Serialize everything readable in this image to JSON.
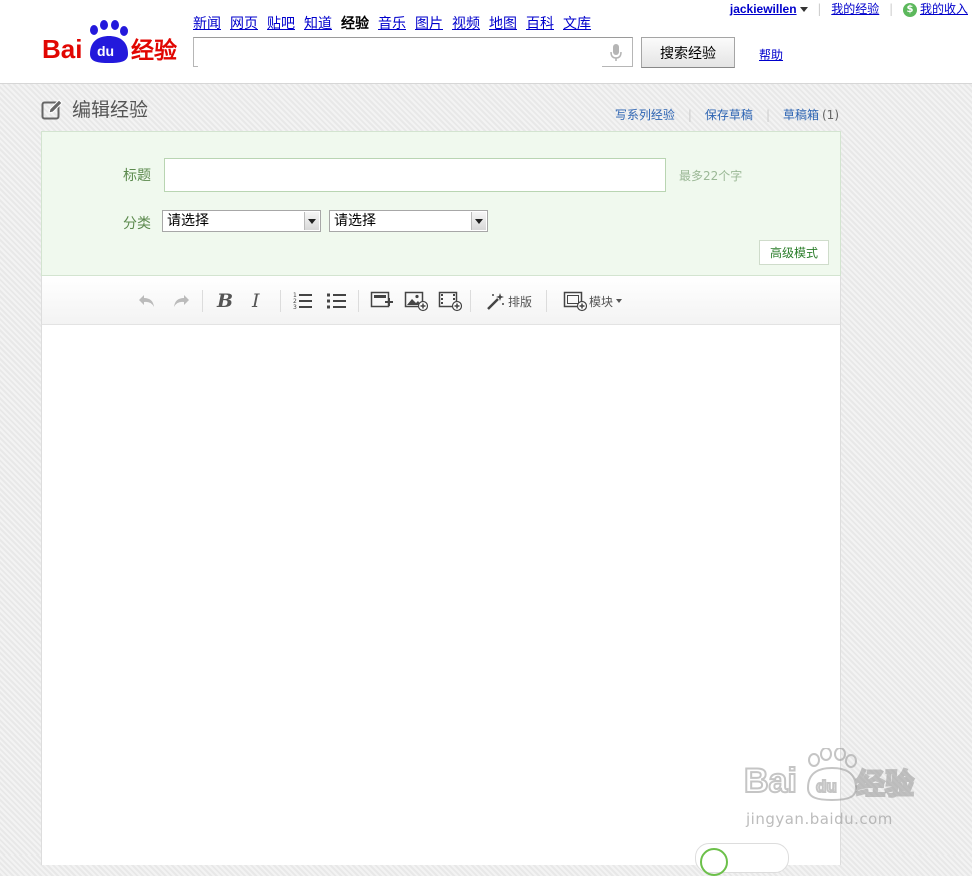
{
  "header": {
    "logo_text": "Baidu经验",
    "nav": [
      "新闻",
      "网页",
      "贴吧",
      "知道",
      "经验",
      "音乐",
      "图片",
      "视频",
      "地图",
      "百科",
      "文库"
    ],
    "nav_current": "经验",
    "search": {
      "value": "",
      "placeholder": "",
      "button_label": "搜索经验"
    },
    "help_label": "帮助",
    "user": {
      "name": "jackiewillen",
      "my_experience": "我的经验",
      "my_income": "我的收入"
    }
  },
  "page": {
    "title": "编辑经验",
    "actions": {
      "series": "写系列经验",
      "save_draft": "保存草稿",
      "drafts": "草稿箱",
      "drafts_count": "(1)"
    }
  },
  "form": {
    "title_label": "标题",
    "title_value": "",
    "title_hint": "最多22个字",
    "category_label": "分类",
    "category1": "请选择",
    "category2": "请选择",
    "advanced_button": "高级模式"
  },
  "toolbar": {
    "items": [
      "undo-icon",
      "redo-icon",
      "bold-icon",
      "italic-icon",
      "ordered-list-icon",
      "unordered-list-icon",
      "insert-step-icon",
      "insert-image-icon",
      "insert-video-icon",
      "magic-wand-icon",
      "module-icon"
    ],
    "layout_label": "排版",
    "module_label": "模块"
  },
  "editor": {
    "content": ""
  },
  "watermark": {
    "brand": "Baidu经验",
    "url": "jingyan.baidu.com"
  },
  "colors": {
    "accent_green": "#5c8a4e",
    "link_blue": "#2d64b3",
    "logo_red": "#e10602",
    "logo_blue": "#2319dc"
  }
}
